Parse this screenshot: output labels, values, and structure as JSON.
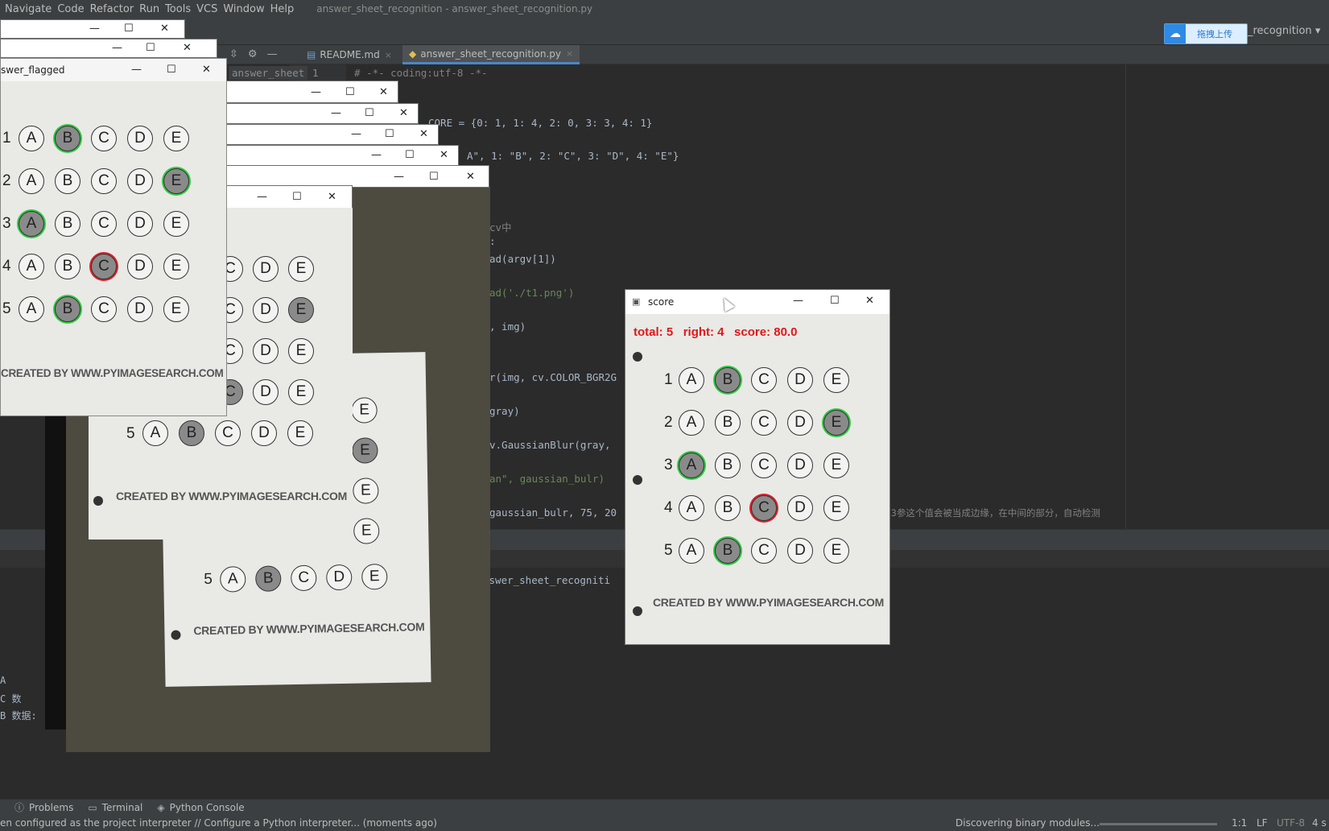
{
  "menu": {
    "items": [
      "Navigate",
      "Code",
      "Refactor",
      "Run",
      "Tools",
      "VCS",
      "Window",
      "Help"
    ],
    "window_title": "answer_sheet_recognition - answer_sheet_recognition.py"
  },
  "toolbar": {
    "upload_label": "拖拽上传",
    "run_config": "_recognition"
  },
  "tabs": [
    {
      "label": "README.md",
      "active": false
    },
    {
      "label": "answer_sheet_recognition.py",
      "active": true
    }
  ],
  "project_label": "answer_sheet",
  "editor": {
    "line_number": "1",
    "lines": [
      "# -*- coding:utf-8 -*-",
      "CORE = {0: 1, 1: 4, 2: 0, 3: 3, 4: 1}",
      "A\", 1: \"B\", 2: \"C\", 3: \"D\", 4: \"E\"}",
      "cv中",
      ":",
      "ad(argv[1])",
      "ad('./t1.png')",
      ", img)",
      "r(img, cv.COLOR_BGR2G",
      "gray)",
      "v.GaussianBlur(gray,",
      "an\", gaussian_bulr)",
      "gaussian_bulr, 75, 20",
      "F3参这个值会被当成边缘，在中间的部分，自动检测"
    ]
  },
  "run_output": {
    "line": "nswer_sheet_recogniti",
    "console_lines": [
      "A",
      "C 数",
      "B 数据:"
    ]
  },
  "tool_windows": [
    "Problems",
    "Terminal",
    "Python Console"
  ],
  "status": {
    "message": "en configured as the project interpreter // Configure a Python interpreter... (moments ago)",
    "progress_text": "Discovering binary modules...",
    "position": "1:1",
    "line_sep": "LF",
    "encoding": "UTF-8",
    "indent": "4 s"
  },
  "windows": {
    "flagged_title": "swer_flagged",
    "score_title": "score"
  },
  "score_window": {
    "total_label": "total: 5",
    "right_label": "right: 4",
    "score_label": "score: 80.0"
  },
  "sheet": {
    "options": [
      "A",
      "B",
      "C",
      "D",
      "E"
    ],
    "numbers": [
      "1",
      "2",
      "3",
      "4",
      "5"
    ],
    "answers": [
      1,
      4,
      0,
      2,
      1
    ],
    "correct": [
      1,
      4,
      0,
      3,
      1
    ],
    "credit": "CREATED BY WWW.PYIMAGESEARCH.COM"
  },
  "colors": {
    "correct_ring": "#2ecc40",
    "wrong_ring": "#e0202a",
    "score_text": "#e01818"
  }
}
